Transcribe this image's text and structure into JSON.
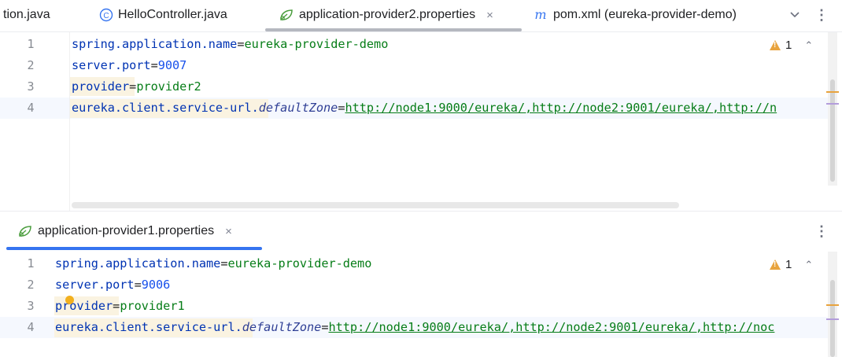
{
  "tabs": [
    {
      "label": "tion.java",
      "icon": "java-file-icon"
    },
    {
      "label": "HelloController.java",
      "icon": "class-c-icon"
    },
    {
      "label": "application-provider2.properties",
      "icon": "spring-leaf-icon",
      "active": true
    },
    {
      "label": "pom.xml (eureka-provider-demo)",
      "icon": "maven-m-icon"
    }
  ],
  "top_editor": {
    "lines": [
      {
        "num": "1",
        "key": "spring.application.name",
        "value": "eureka-provider-demo"
      },
      {
        "num": "2",
        "key": "server.port",
        "value": "9007"
      },
      {
        "num": "3",
        "key": "provider",
        "value": "provider2"
      },
      {
        "num": "4",
        "key_prefix": "eureka.client.service-url.",
        "key_italic": "defaultZone",
        "value": "http://node1:9000/eureka/,http://node2:9001/eureka/,http://n"
      }
    ],
    "warning_count": "1"
  },
  "bottom_editor": {
    "tab_label": "application-provider1.properties",
    "lines": [
      {
        "num": "1",
        "key": "spring.application.name",
        "value": "eureka-provider-demo"
      },
      {
        "num": "2",
        "key": "server.port",
        "value": "9006"
      },
      {
        "num": "3",
        "key": "provider",
        "value": "provider1"
      },
      {
        "num": "4",
        "key_prefix": "eureka.client.service-url.",
        "key_italic": "defaultZone",
        "value": "http://node1:9000/eureka/,http://node2:9001/eureka/,http://noc"
      }
    ],
    "warning_count": "1"
  },
  "glyphs": {
    "eq": "=",
    "close": "×",
    "chevron_down": "⌄",
    "up": "⌃",
    "down": "⌄",
    "kebab": "⋮"
  },
  "colors": {
    "key": "#0033b3",
    "value": "#067d17",
    "number": "#1750eb",
    "accent": "#3574f0",
    "warning": "#e8a33d"
  }
}
